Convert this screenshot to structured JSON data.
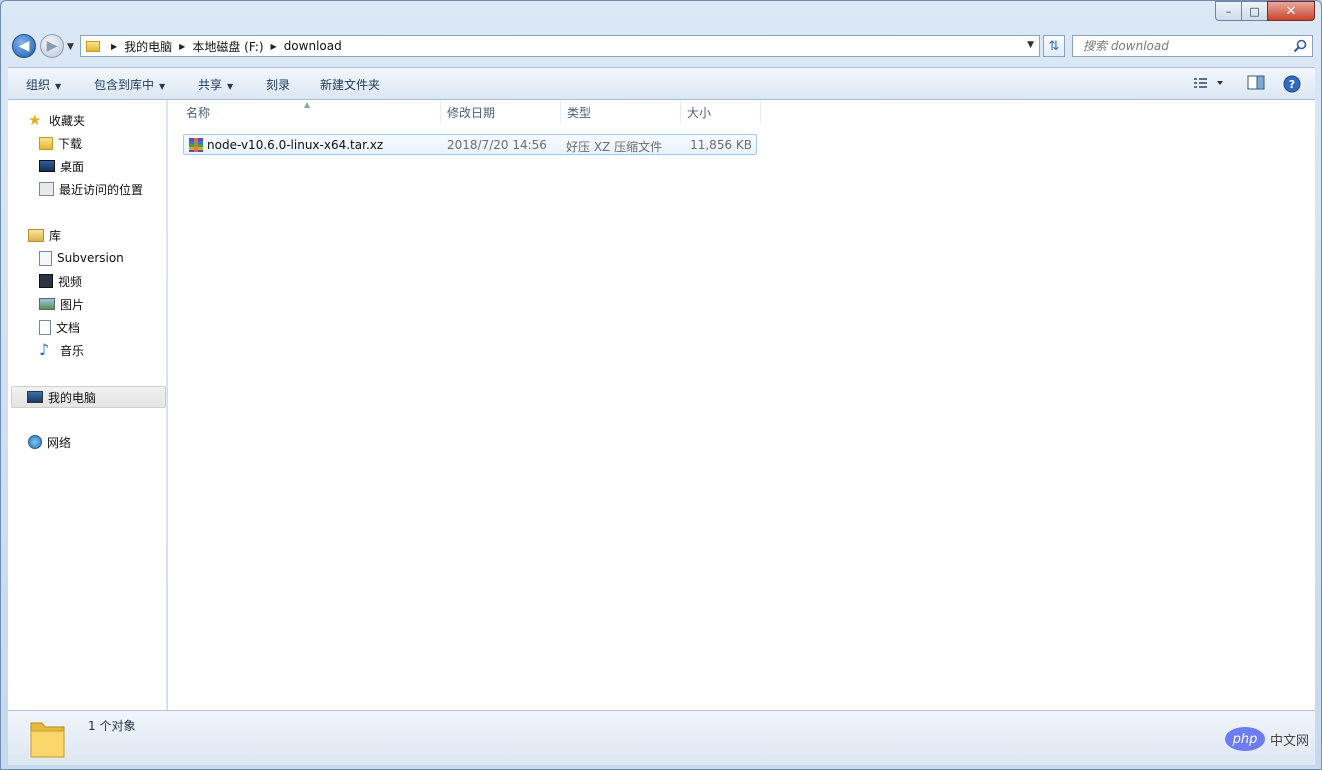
{
  "window": {
    "minimize": "–",
    "maximize": "□",
    "close": "✕"
  },
  "nav": {
    "back_icon": "arrow-left-icon",
    "forward_icon": "arrow-right-icon",
    "breadcrumbs": [
      "我的电脑",
      "本地磁盘 (F:)",
      "download"
    ],
    "search_placeholder": "搜索 download"
  },
  "toolbar": {
    "organize": "组织",
    "include_library": "包含到库中",
    "share": "共享",
    "burn": "刻录",
    "new_folder": "新建文件夹"
  },
  "sidebar": {
    "favorites": {
      "label": "收藏夹",
      "items": [
        {
          "label": "下载",
          "icon": "download-folder-icon"
        },
        {
          "label": "桌面",
          "icon": "desktop-icon"
        },
        {
          "label": "最近访问的位置",
          "icon": "recent-places-icon"
        }
      ]
    },
    "libraries": {
      "label": "库",
      "items": [
        {
          "label": "Subversion",
          "icon": "document-library-icon"
        },
        {
          "label": "视频",
          "icon": "video-icon"
        },
        {
          "label": "图片",
          "icon": "picture-icon"
        },
        {
          "label": "文档",
          "icon": "document-icon"
        },
        {
          "label": "音乐",
          "icon": "music-icon"
        }
      ]
    },
    "computer": "我的电脑",
    "network": "网络"
  },
  "table": {
    "columns": [
      "名称",
      "修改日期",
      "类型",
      "大小"
    ],
    "rows": [
      {
        "name": "node-v10.6.0-linux-x64.tar.xz",
        "modified": "2018/7/20 14:56",
        "type": "好压 XZ 压缩文件",
        "size": "11,856 KB"
      }
    ]
  },
  "status": {
    "count": "1 个对象"
  },
  "watermark": {
    "badge": "php",
    "text": "中文网"
  },
  "colors": {
    "accent": "#1f5ca9",
    "selection": "#e8f2fd"
  }
}
